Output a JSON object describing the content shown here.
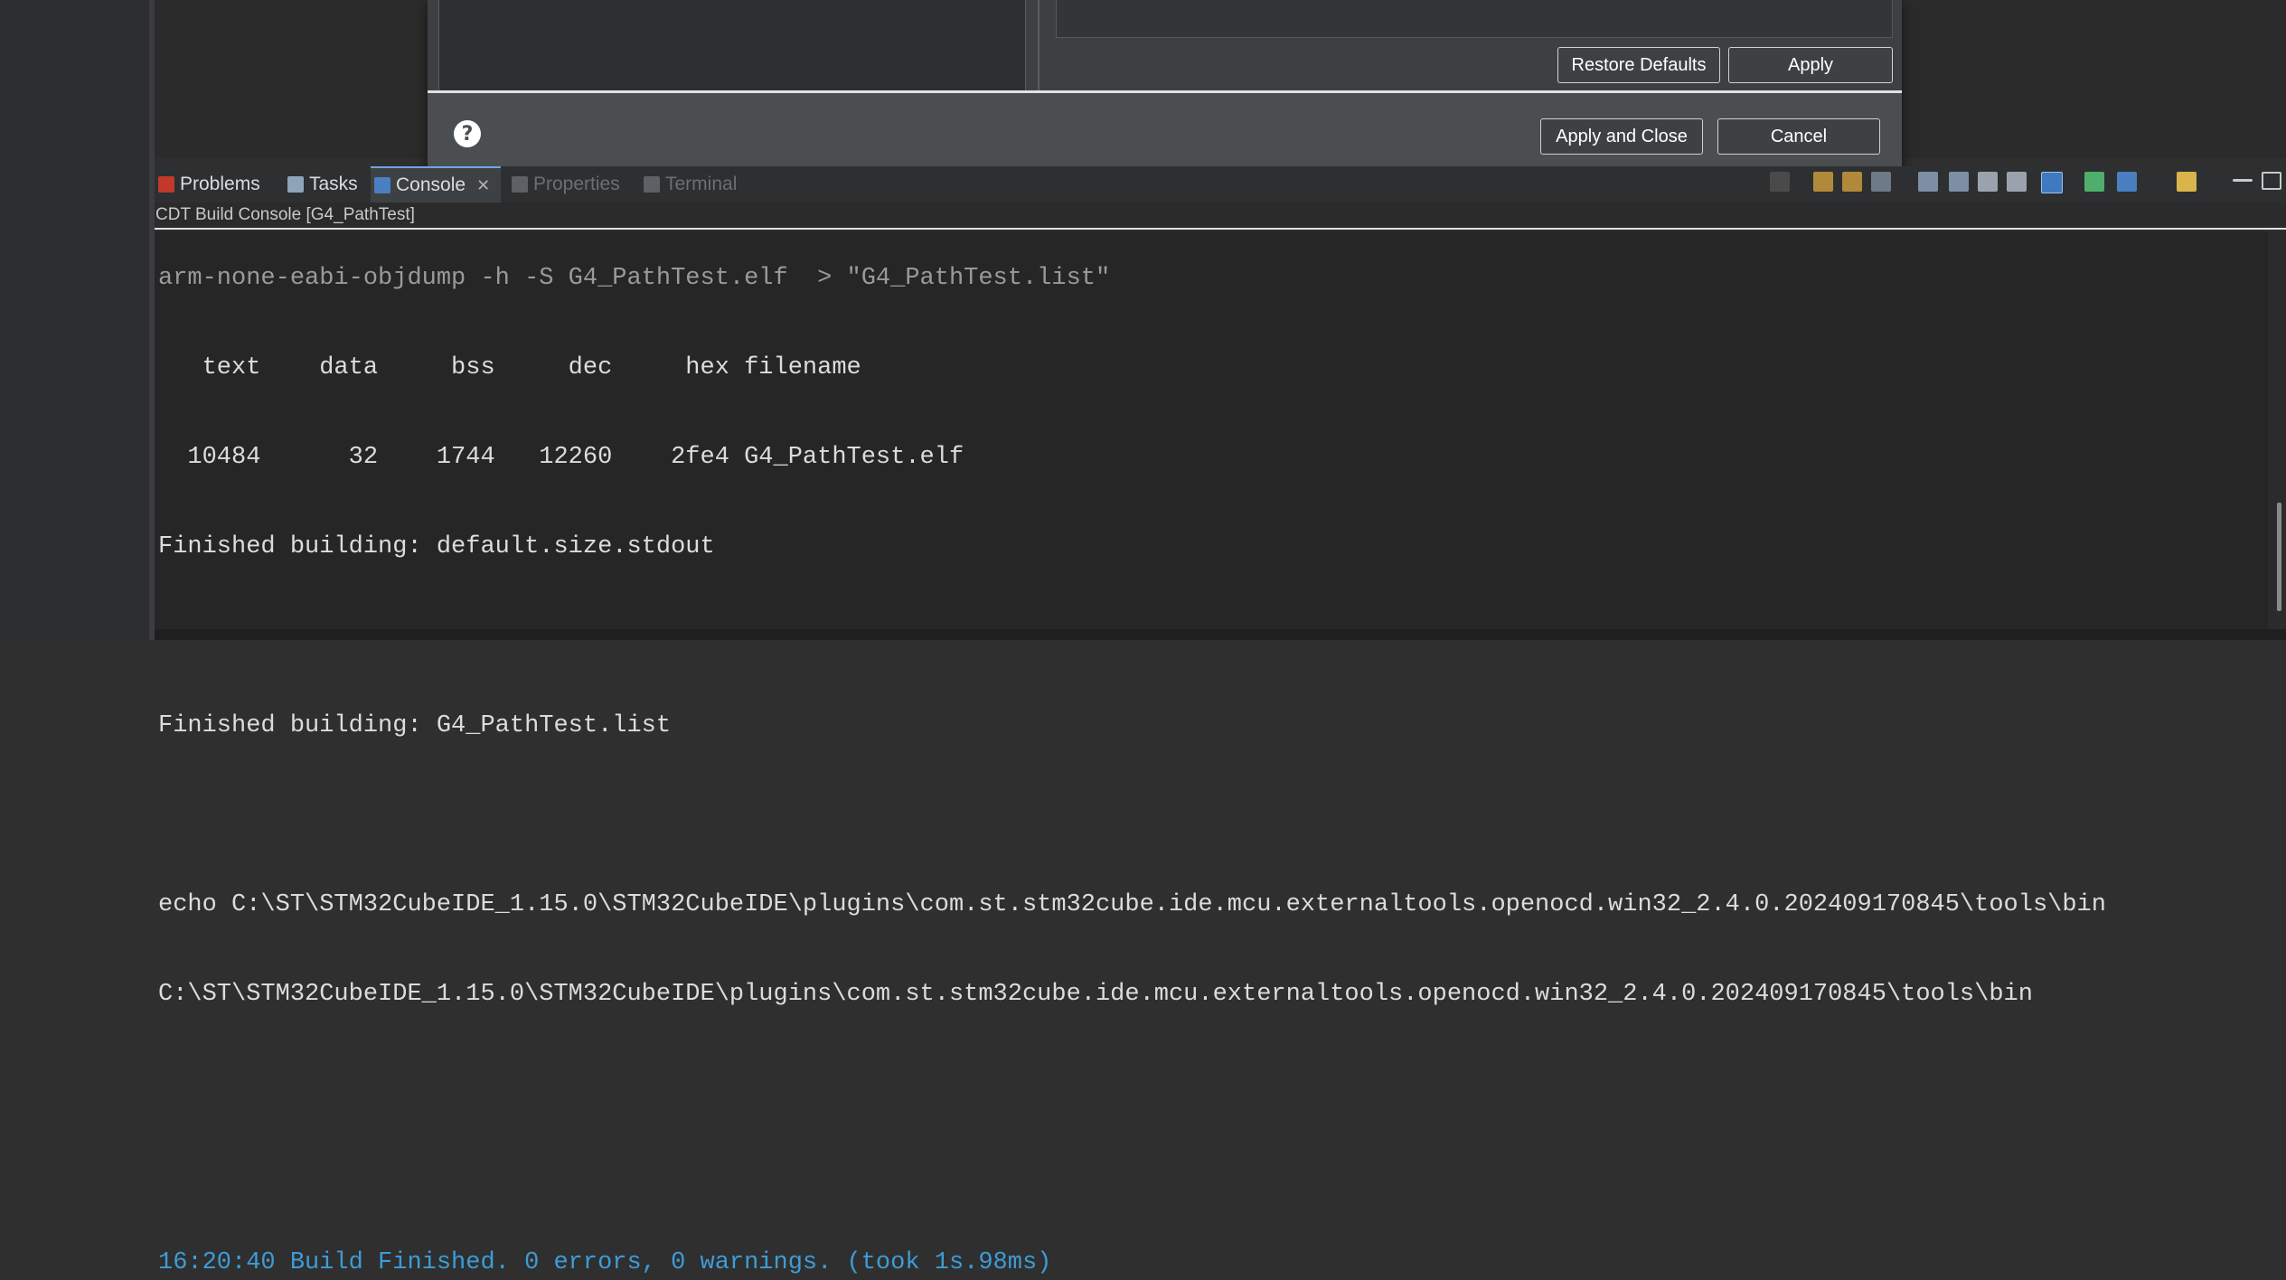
{
  "dialog": {
    "restore_defaults_label": "Restore Defaults",
    "apply_label": "Apply",
    "apply_and_close_label": "Apply and Close",
    "cancel_label": "Cancel",
    "help_icon": "help-icon"
  },
  "tabs": [
    {
      "label": "Problems",
      "icon": "problems-icon"
    },
    {
      "label": "Tasks",
      "icon": "tasks-icon"
    },
    {
      "label": "Console",
      "icon": "console-icon",
      "active": true
    },
    {
      "label": "Properties",
      "icon": "properties-icon"
    },
    {
      "label": "Terminal",
      "icon": "terminal-icon"
    }
  ],
  "console": {
    "title": "CDT Build Console [G4_PathTest]",
    "lines": [
      "arm-none-eabi-objdump -h -S G4_PathTest.elf  > \"G4_PathTest.list\"",
      "   text    data     bss     dec     hex filename",
      "  10484      32    1744   12260    2fe4 G4_PathTest.elf",
      "Finished building: default.size.stdout",
      "",
      "Finished building: G4_PathTest.list",
      "",
      "echo C:\\ST\\STM32CubeIDE_1.15.0\\STM32CubeIDE\\plugins\\com.st.stm32cube.ide.mcu.externaltools.openocd.win32_2.4.0.202409170845\\tools\\bin",
      "C:\\ST\\STM32CubeIDE_1.15.0\\STM32CubeIDE\\plugins\\com.st.stm32cube.ide.mcu.externaltools.openocd.win32_2.4.0.202409170845\\tools\\bin",
      "",
      "",
      "16:20:40 Build Finished. 0 errors, 0 warnings. (took 1s.98ms)"
    ]
  },
  "colors": {
    "accent_blue": "#3d9cd6",
    "console_bg": "#262626",
    "dialog_bg": "#3d4043"
  }
}
